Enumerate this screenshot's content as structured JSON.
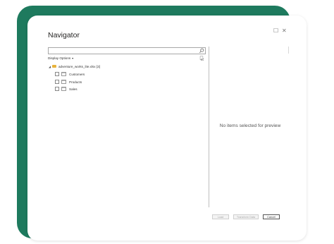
{
  "window": {
    "title": "Navigator",
    "maximize_glyph": "☐",
    "close_glyph": "✕"
  },
  "search": {
    "value": "",
    "placeholder": ""
  },
  "display_options": {
    "label": "Display Options",
    "caret": "▾"
  },
  "tree": {
    "root": {
      "label": "adventure_works_lite.xlsx [3]",
      "expander": "◢"
    },
    "items": [
      {
        "label": "Customers"
      },
      {
        "label": "Products"
      },
      {
        "label": "Sales"
      }
    ]
  },
  "preview": {
    "message": "No items selected for preview"
  },
  "buttons": {
    "load": "Load",
    "transform": "Transform Data",
    "cancel": "Cancel"
  },
  "colors": {
    "backdrop": "#1e7a5e",
    "folder": "#e8b33b"
  },
  "icons": [
    "search-icon",
    "refresh-icon",
    "folder-icon",
    "table-icon",
    "maximize-icon",
    "close-icon"
  ]
}
